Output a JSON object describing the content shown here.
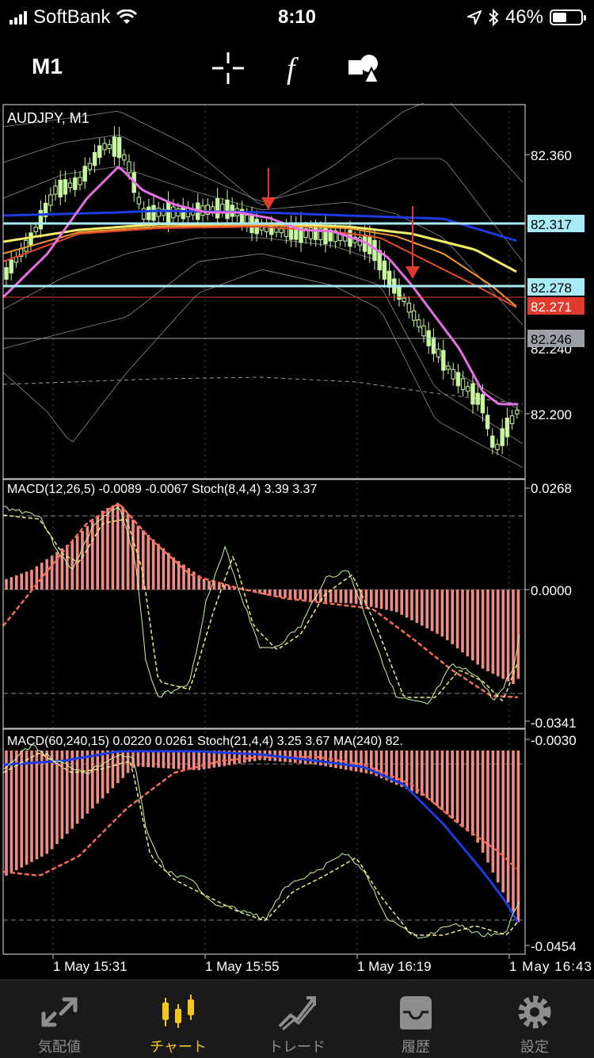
{
  "status_bar": {
    "carrier": "SoftBank",
    "time": "8:10",
    "battery": "46%",
    "battery_level": 0.46
  },
  "toolbar": {
    "timeframe": "M1",
    "icons": [
      "crosshair-icon",
      "function-icon",
      "objects-icon"
    ]
  },
  "main_chart": {
    "title": "AUDJPY, M1",
    "price_labels": [
      "82.360",
      "82.240",
      "82.200"
    ],
    "highlight_lines": [
      {
        "label": "82.317",
        "color": "#a8eaf8",
        "line_color": "#a8eaf8"
      },
      {
        "label": "82.278",
        "color": "#a8eaf8",
        "line_color": "#a8eaf8"
      },
      {
        "label": "82.271",
        "color": "#e23b2d",
        "line_color": "#e23b2d"
      },
      {
        "label": "82.246",
        "color": "#9aa0a6",
        "line_color": "#9aa0a6"
      }
    ],
    "arrows": 2
  },
  "indicator1": {
    "label": "MACD(12,26,5) -0.0089 -0.0067 Stoch(8,4,4) 3.39 3.37",
    "scale": [
      "0.0268",
      "0.0000",
      "-0.0341"
    ]
  },
  "indicator2": {
    "label": "MACD(60,240,15) 0.0220 0.0261 Stoch(21,4,4) 3.25 3.67 MA(240) 82.",
    "scale": [
      "-0.0030",
      "-0.0454"
    ]
  },
  "time_axis": [
    "1 May 15:31",
    "1 May 15:55",
    "1 May 16:19",
    "1 May 16:43"
  ],
  "colors": {
    "candle": "#c8f7a0",
    "macd_hist": "#f08c80",
    "signal": "#f36d5a",
    "ma_blue": "#1c3be0",
    "ma_yellow": "#f3ef6a",
    "ma_orange": "#f59a2b",
    "ma_red": "#e34a2d",
    "ma_magenta": "#e86ee6",
    "accent": "#f5c518"
  },
  "tabs": [
    {
      "label": "気配値",
      "icon": "quotes-icon",
      "active": false
    },
    {
      "label": "チャート",
      "icon": "chart-icon",
      "active": true
    },
    {
      "label": "トレード",
      "icon": "trade-icon",
      "active": false
    },
    {
      "label": "履歴",
      "icon": "history-icon",
      "active": false
    },
    {
      "label": "設定",
      "icon": "settings-icon",
      "active": false
    }
  ]
}
